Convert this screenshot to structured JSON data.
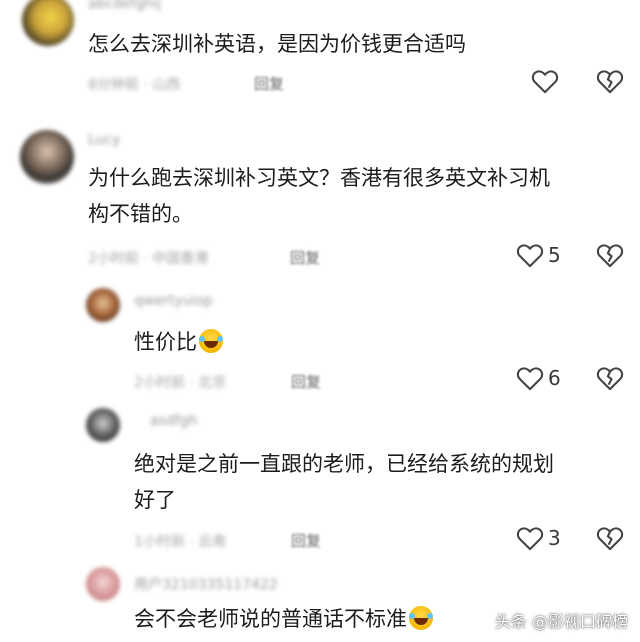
{
  "comments": [
    {
      "text_lines": [
        "怎么去深圳补英语，是因为价钱更合适吗"
      ],
      "like_count": "",
      "reply_label": "回复"
    },
    {
      "username": "Lucy",
      "text_lines": [
        "为什么跑去深圳补习英文？香港有很多英文补习机",
        "构不错的。"
      ],
      "like_count": "5",
      "reply_label": "回复"
    },
    {
      "text_lines": [
        "性价比"
      ],
      "like_count": "6",
      "reply_label": "回复"
    },
    {
      "text_lines": [
        "绝对是之前一直跟的老师，已经给系统的规划",
        "好了"
      ],
      "like_count": "3",
      "reply_label": "回复"
    },
    {
      "username": "用户3210335117422",
      "text_lines": [
        "会不会老师说的普通话不标准"
      ]
    }
  ],
  "watermark": "头条 @影视口碑榜",
  "icons": {
    "like": "heart-outline-icon",
    "dislike": "broken-heart-outline-icon",
    "emoji": "rofl-emoji-icon"
  },
  "colors": {
    "text": "#1c1c1c",
    "meta": "#a3a3a3",
    "icon": "#444444"
  }
}
